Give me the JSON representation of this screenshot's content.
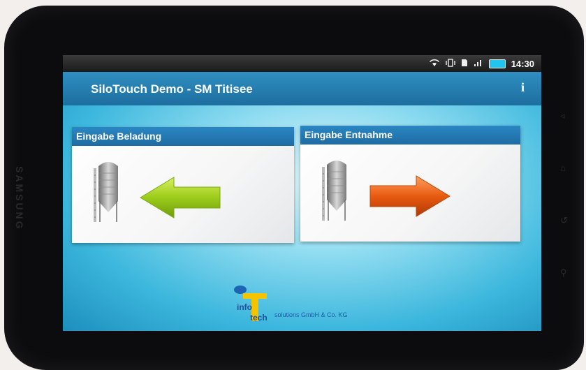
{
  "device": {
    "brand": "SAMSUNG"
  },
  "statusbar": {
    "time": "14:30",
    "icons": [
      "wifi-icon",
      "vibrate-icon",
      "sd-card-icon",
      "signal-icon",
      "battery-icon"
    ]
  },
  "app": {
    "title": "SiloTouch Demo - SM Titisee",
    "info_label": "i"
  },
  "tiles": [
    {
      "label": "Eingabe Beladung",
      "arrow_color": "#9ccc1a",
      "direction": "left"
    },
    {
      "label": "Eingabe Entnahme",
      "arrow_color": "#e85a10",
      "direction": "right"
    }
  ],
  "logo": {
    "word1": "info",
    "word2": "tech",
    "company": "solutions GmbH & Co. KG"
  }
}
